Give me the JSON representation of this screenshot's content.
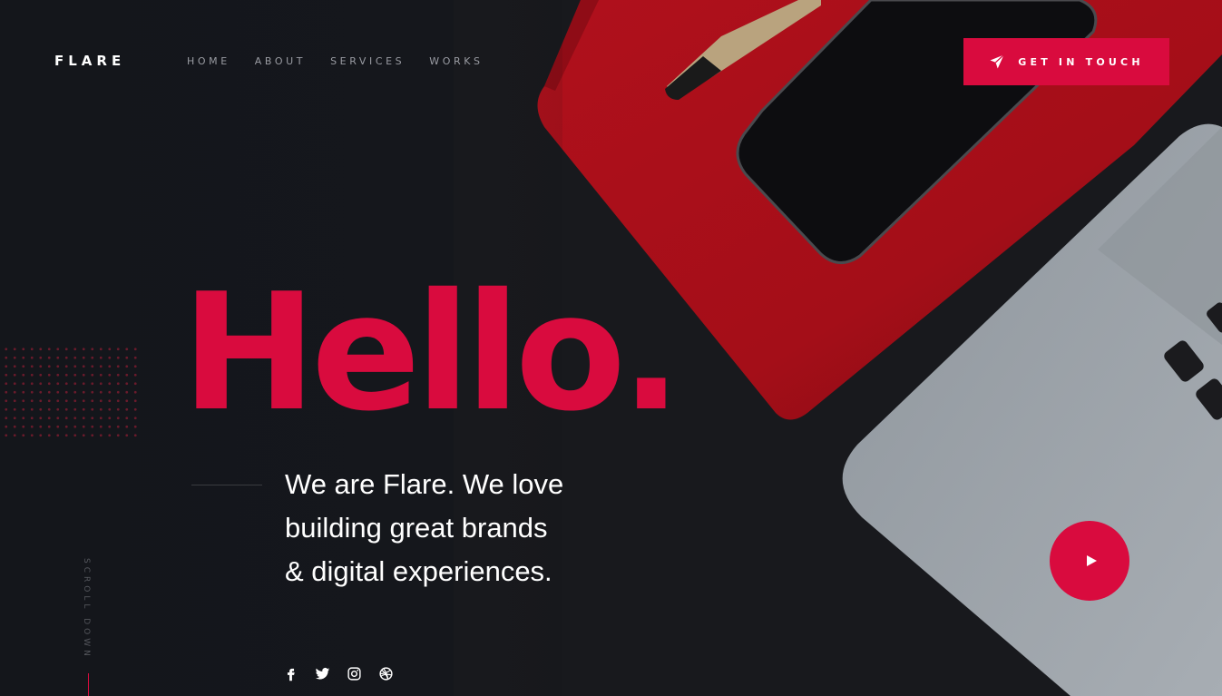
{
  "brand": {
    "logo": "FLARE"
  },
  "nav": {
    "items": [
      {
        "label": "HOME"
      },
      {
        "label": "ABOUT"
      },
      {
        "label": "SERVICES"
      },
      {
        "label": "WORKS"
      }
    ]
  },
  "cta": {
    "label": "GET IN TOUCH",
    "icon": "paper-plane-icon"
  },
  "hero": {
    "headline": "Hello.",
    "tagline_lines": [
      "We are Flare. We love",
      "building great brands",
      "& digital experiences."
    ]
  },
  "scroll": {
    "label": "SCROLL DOWN"
  },
  "social": [
    "facebook-icon",
    "twitter-icon",
    "instagram-icon",
    "dribbble-icon"
  ],
  "video": {
    "icon": "play-icon"
  },
  "colors": {
    "accent": "#d90b3e",
    "background": "#14161b",
    "text": "#ffffff",
    "muted": "#9a9ca3"
  }
}
